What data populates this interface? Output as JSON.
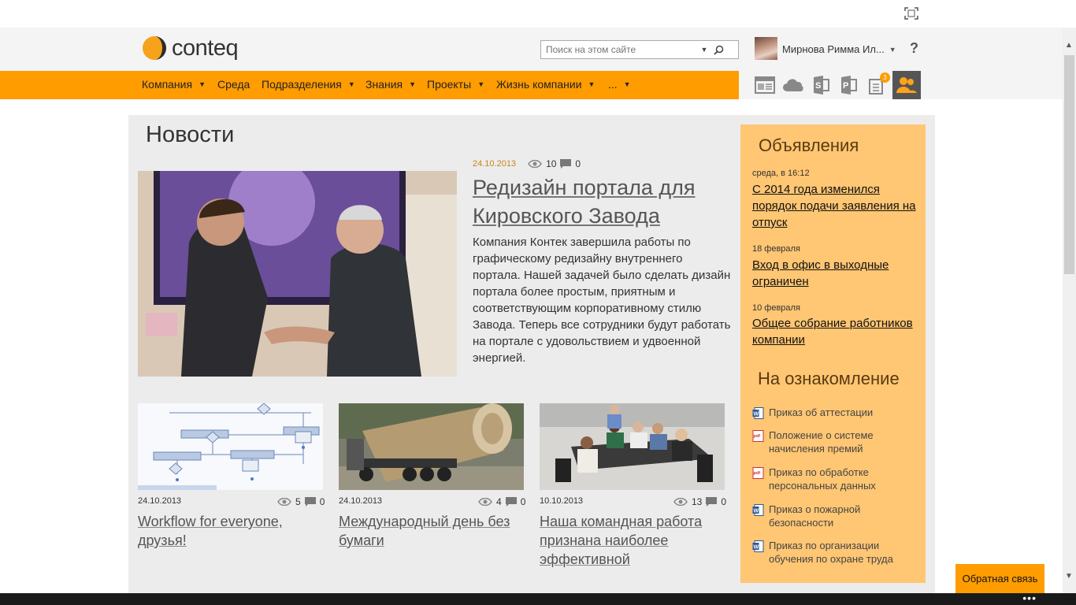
{
  "header": {
    "logo_text": "conteq",
    "search_placeholder": "Поиск на этом сайте",
    "user_name": "Мирнова Римма Ил...",
    "help_label": "?"
  },
  "nav": {
    "items": [
      {
        "label": "Компания",
        "has_dropdown": true
      },
      {
        "label": "Среда",
        "has_dropdown": false
      },
      {
        "label": "Подразделения",
        "has_dropdown": true
      },
      {
        "label": "Знания",
        "has_dropdown": true
      },
      {
        "label": "Проекты",
        "has_dropdown": true
      },
      {
        "label": "Жизнь компании",
        "has_dropdown": true
      },
      {
        "label": "...",
        "has_dropdown": true
      }
    ],
    "toolbar_icons": [
      "newsfeed-icon",
      "onedrive-icon",
      "sharepoint-icon",
      "project-icon",
      "tasks-icon",
      "people-icon"
    ],
    "tasks_badge": "3"
  },
  "news": {
    "title": "Новости",
    "hero": {
      "date": "24.10.2013",
      "views": "10",
      "comments": "0",
      "title": "Редизайн портала для Кировского Завода",
      "text": "Компания Контек завершила работы по графическому редизайну внутреннего портала. Нашей задачей было сделать дизайн портала более простым, приятным и соответствующим корпоративному стилю Завода. Теперь все сотрудники будут работать на портале с удовольствием и удвоенной энергией."
    },
    "cards": [
      {
        "date": "24.10.2013",
        "views": "5",
        "comments": "0",
        "title": "Workflow for everyone, друзья!"
      },
      {
        "date": "24.10.2013",
        "views": "4",
        "comments": "0",
        "title": "Международный день без бумаги"
      },
      {
        "date": "10.10.2013",
        "views": "13",
        "comments": "0",
        "title": "Наша командная работа признана наиболее эффективной"
      }
    ]
  },
  "announcements": {
    "title": "Объявления",
    "items": [
      {
        "date": "среда, в 16:12",
        "title": "С 2014 года изменился порядок подачи заявления на отпуск"
      },
      {
        "date": "18 февраля",
        "title": "Вход в офис в выходные ограничен"
      },
      {
        "date": "10 февраля",
        "title": "Общее собрание работников компании"
      }
    ]
  },
  "review": {
    "title": "На ознакомление",
    "docs": [
      {
        "type": "word",
        "title": "Приказ об аттестации"
      },
      {
        "type": "pdf",
        "title": "Положение о системе начисления премий"
      },
      {
        "type": "pdf",
        "title": "Приказ по обработке персональных данных"
      },
      {
        "type": "word",
        "title": "Приказ о пожарной безопасности"
      },
      {
        "type": "word",
        "title": "Приказ по организации обучения по охране труда"
      }
    ]
  },
  "feedback_label": "Обратная связь",
  "colors": {
    "accent": "#ff9c00",
    "sidebar": "#ffc673",
    "content_bg": "#ececec"
  }
}
